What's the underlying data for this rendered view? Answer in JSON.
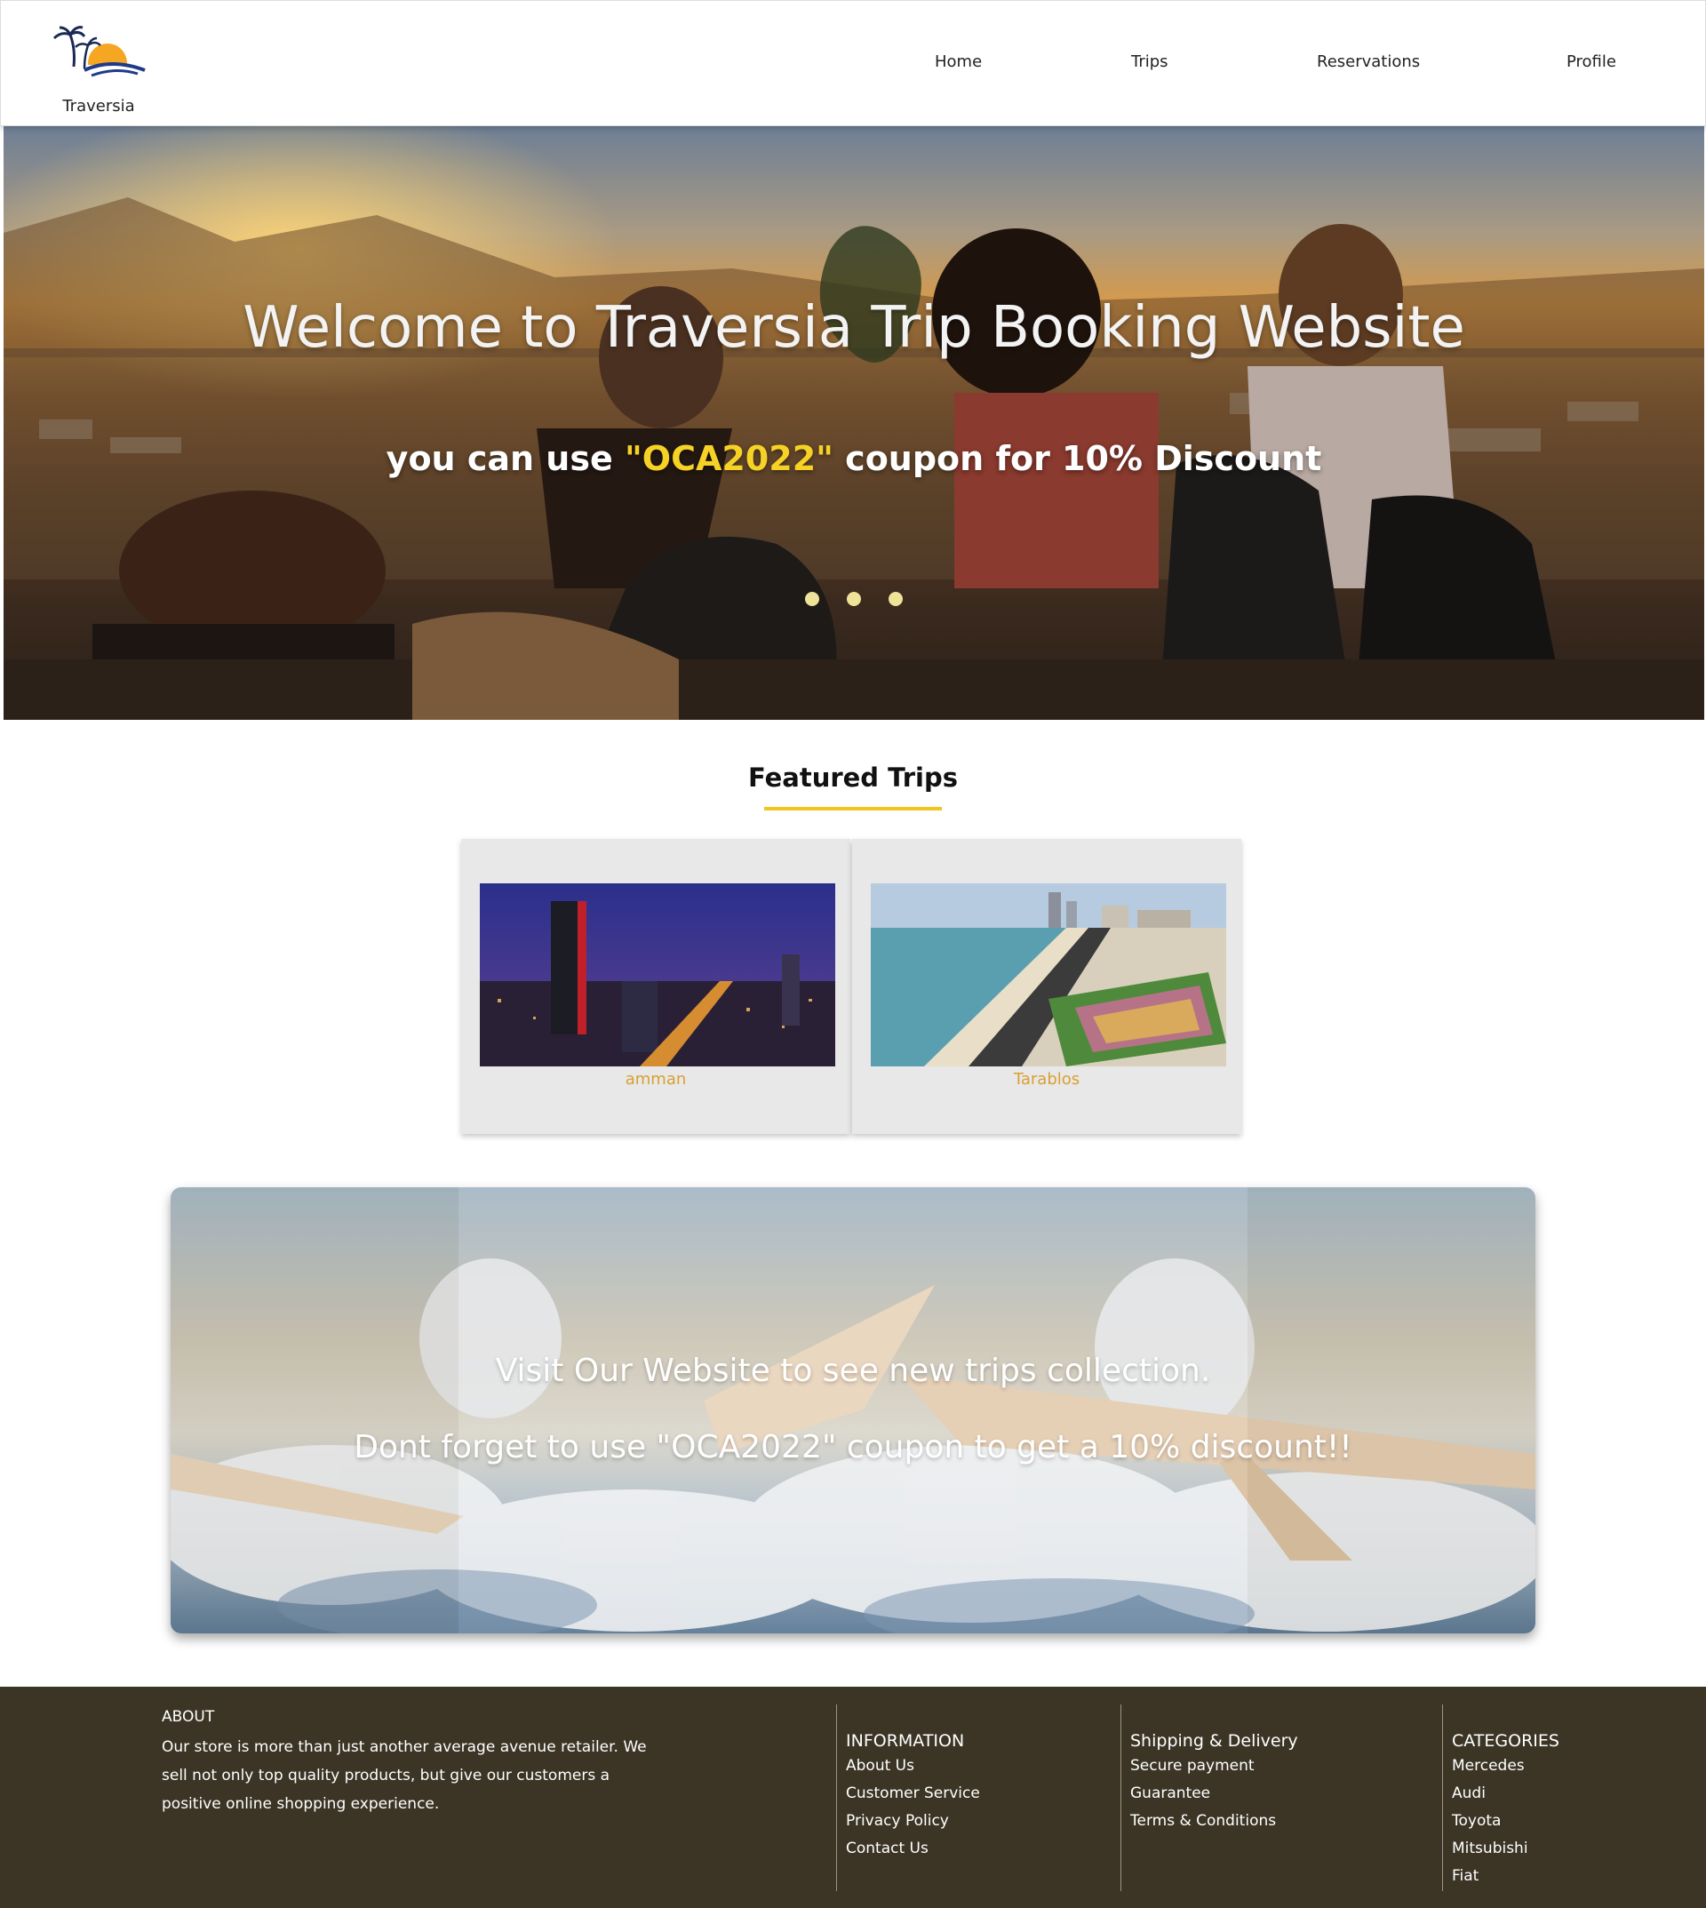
{
  "navbar": {
    "brand": "Traversia",
    "links": [
      "Home",
      "Trips",
      "Reservations",
      "Profile"
    ]
  },
  "hero": {
    "title": "Welcome to Traversia Trip Booking Website",
    "subtitle_before": "you can use ",
    "coupon": "\"OCA2022\"",
    "subtitle_after": " coupon for 10% Discount",
    "slide_count": 3,
    "coupon_color": "#f6d227"
  },
  "featured": {
    "title": "Featured Trips",
    "trips": [
      {
        "name": "amman"
      },
      {
        "name": "Tarablos"
      }
    ]
  },
  "promo": {
    "line1": "Visit Our Website to see new trips collection.",
    "line2": "Dont forget to use \"OCA2022\" coupon to get a 10% discount!!"
  },
  "footer": {
    "about_heading": "ABOUT",
    "about_text": "Our store is more than just another average avenue retailer. We sell not only top quality products, but give our customers a positive online shopping experience.",
    "information": {
      "heading": "INFORMATION",
      "links": [
        "About Us",
        "Customer Service",
        "Privacy Policy",
        "Contact Us"
      ]
    },
    "shipping": {
      "heading": "Shipping & Delivery",
      "links": [
        "Secure payment",
        "Guarantee",
        "Terms & Conditions"
      ]
    },
    "categories": {
      "heading": "CATEGORIES",
      "links": [
        "Mercedes",
        "Audi",
        "Toyota",
        "Mitsubishi",
        "Fiat"
      ]
    },
    "background_color": "#3c3526"
  },
  "accent_color": "#f1c51f"
}
